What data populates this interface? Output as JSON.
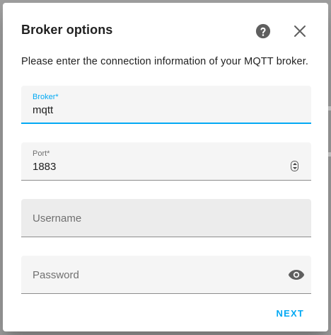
{
  "dialog": {
    "title": "Broker options",
    "description": "Please enter the connection information of your MQTT broker.",
    "help_icon": "help-circle-icon",
    "close_icon": "close-icon"
  },
  "fields": {
    "broker": {
      "label": "Broker*",
      "value": "mqtt"
    },
    "port": {
      "label": "Port*",
      "value": "1883",
      "spinner_icon": "number-spinner-icon"
    },
    "username": {
      "placeholder": "Username"
    },
    "password": {
      "placeholder": "Password",
      "toggle_icon": "eye-icon"
    }
  },
  "actions": {
    "next_label": "NEXT"
  },
  "colors": {
    "accent": "#03a9f4",
    "text": "#212121",
    "field_bg": "#f5f5f5"
  }
}
